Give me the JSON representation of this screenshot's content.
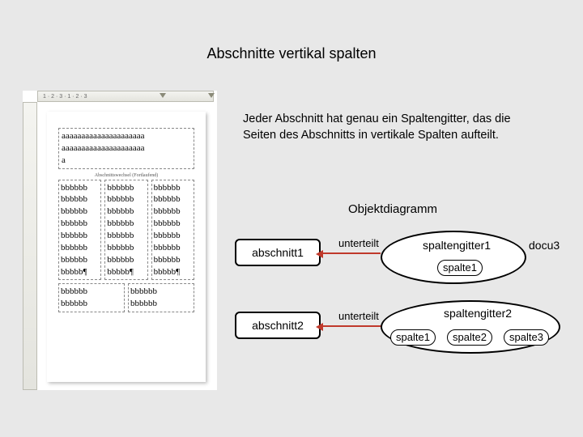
{
  "title": "Abschnitte vertikal spalten",
  "description": "Jeder Abschnitt hat genau ein Spaltengitter, das die Seiten des Abschnitts in  vertikale Spalten aufteilt.",
  "diagram_title": "Objektdiagramm",
  "ruler": {
    "markers": "1 · 2 · 3 · 1 · 2 · 3"
  },
  "section_a": {
    "lines": [
      "aaaaaaaaaaaaaaaaaaaaa",
      "aaaaaaaaaaaaaaaaaaaaa",
      "a"
    ],
    "caption": "Abschnittswechsel (Fortlaufend)"
  },
  "col_b": [
    "bbbbbb",
    "bbbbbb",
    "bbbbbb",
    "bbbbbb",
    "bbbbbb",
    "bbbbbb",
    "bbbbbb",
    "bbbbb¶"
  ],
  "col_b_short": [
    "bbbbbb",
    "bbbbbb"
  ],
  "diagram": {
    "abschnitt1": "abschnitt1",
    "abschnitt2": "abschnitt2",
    "unterteilt": "unterteilt",
    "spaltengitter1": "spaltengitter1",
    "spaltengitter2": "spaltengitter2",
    "spalte1": "spalte1",
    "spalte2": "spalte2",
    "spalte3": "spalte3",
    "docu3": "docu3"
  }
}
